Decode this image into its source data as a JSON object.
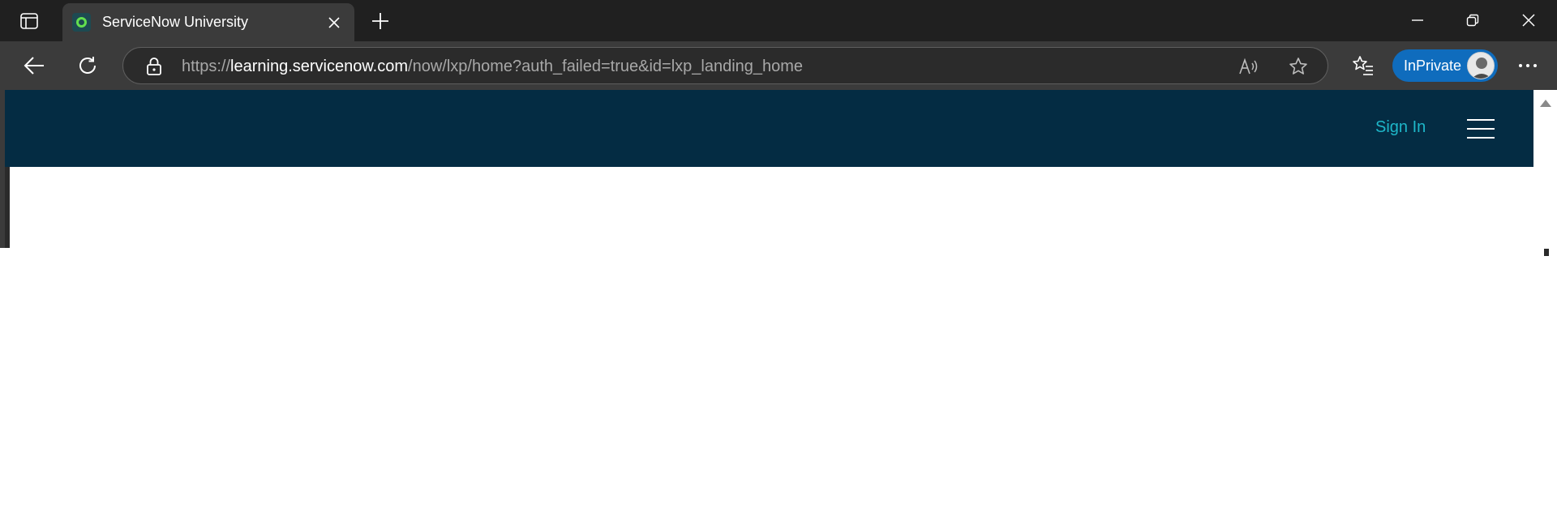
{
  "browser": {
    "tab": {
      "title": "ServiceNow University",
      "favicon": "servicenow-favicon"
    },
    "address": {
      "scheme": "https://",
      "host": "learning.servicenow.com",
      "path": "/now/lxp/home?auth_failed=true&id=lxp_landing_home"
    },
    "inprivate_label": "InPrivate"
  },
  "site": {
    "header_color": "#042c43",
    "accent_color": "#1eb7c9",
    "sign_in_label": "Sign In",
    "menu_icon": "hamburger-menu-icon"
  }
}
